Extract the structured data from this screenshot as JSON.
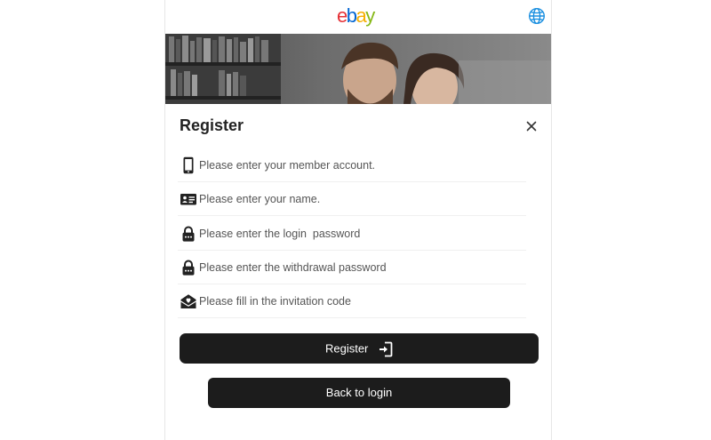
{
  "header": {
    "logo_letters": [
      {
        "char": "e",
        "color": "#e53238"
      },
      {
        "char": "b",
        "color": "#0064d2"
      },
      {
        "char": "a",
        "color": "#f5af02"
      },
      {
        "char": "y",
        "color": "#86b817"
      }
    ],
    "globe_icon": "globe-icon",
    "globe_color": "#1a8fe0"
  },
  "hero": {
    "image": "couple-photo"
  },
  "modal": {
    "title": "Register",
    "close_icon": "close-icon"
  },
  "form": {
    "fields": [
      {
        "icon": "phone-icon",
        "placeholder": "Please enter your member account.",
        "value": ""
      },
      {
        "icon": "id-card-icon",
        "placeholder": "Please enter your name.",
        "value": ""
      },
      {
        "icon": "lock-icon",
        "placeholder": "Please enter the login  password",
        "value": ""
      },
      {
        "icon": "lock-icon",
        "placeholder": "Please enter the withdrawal password",
        "value": ""
      },
      {
        "icon": "envelope-heart-icon",
        "placeholder": "Please fill in the invitation code",
        "value": ""
      }
    ]
  },
  "actions": {
    "register_label": "Register",
    "register_icon": "sign-in-icon",
    "back_label": "Back to login"
  },
  "colors": {
    "button_bg": "#1c1c1c",
    "button_text": "#ffffff"
  }
}
